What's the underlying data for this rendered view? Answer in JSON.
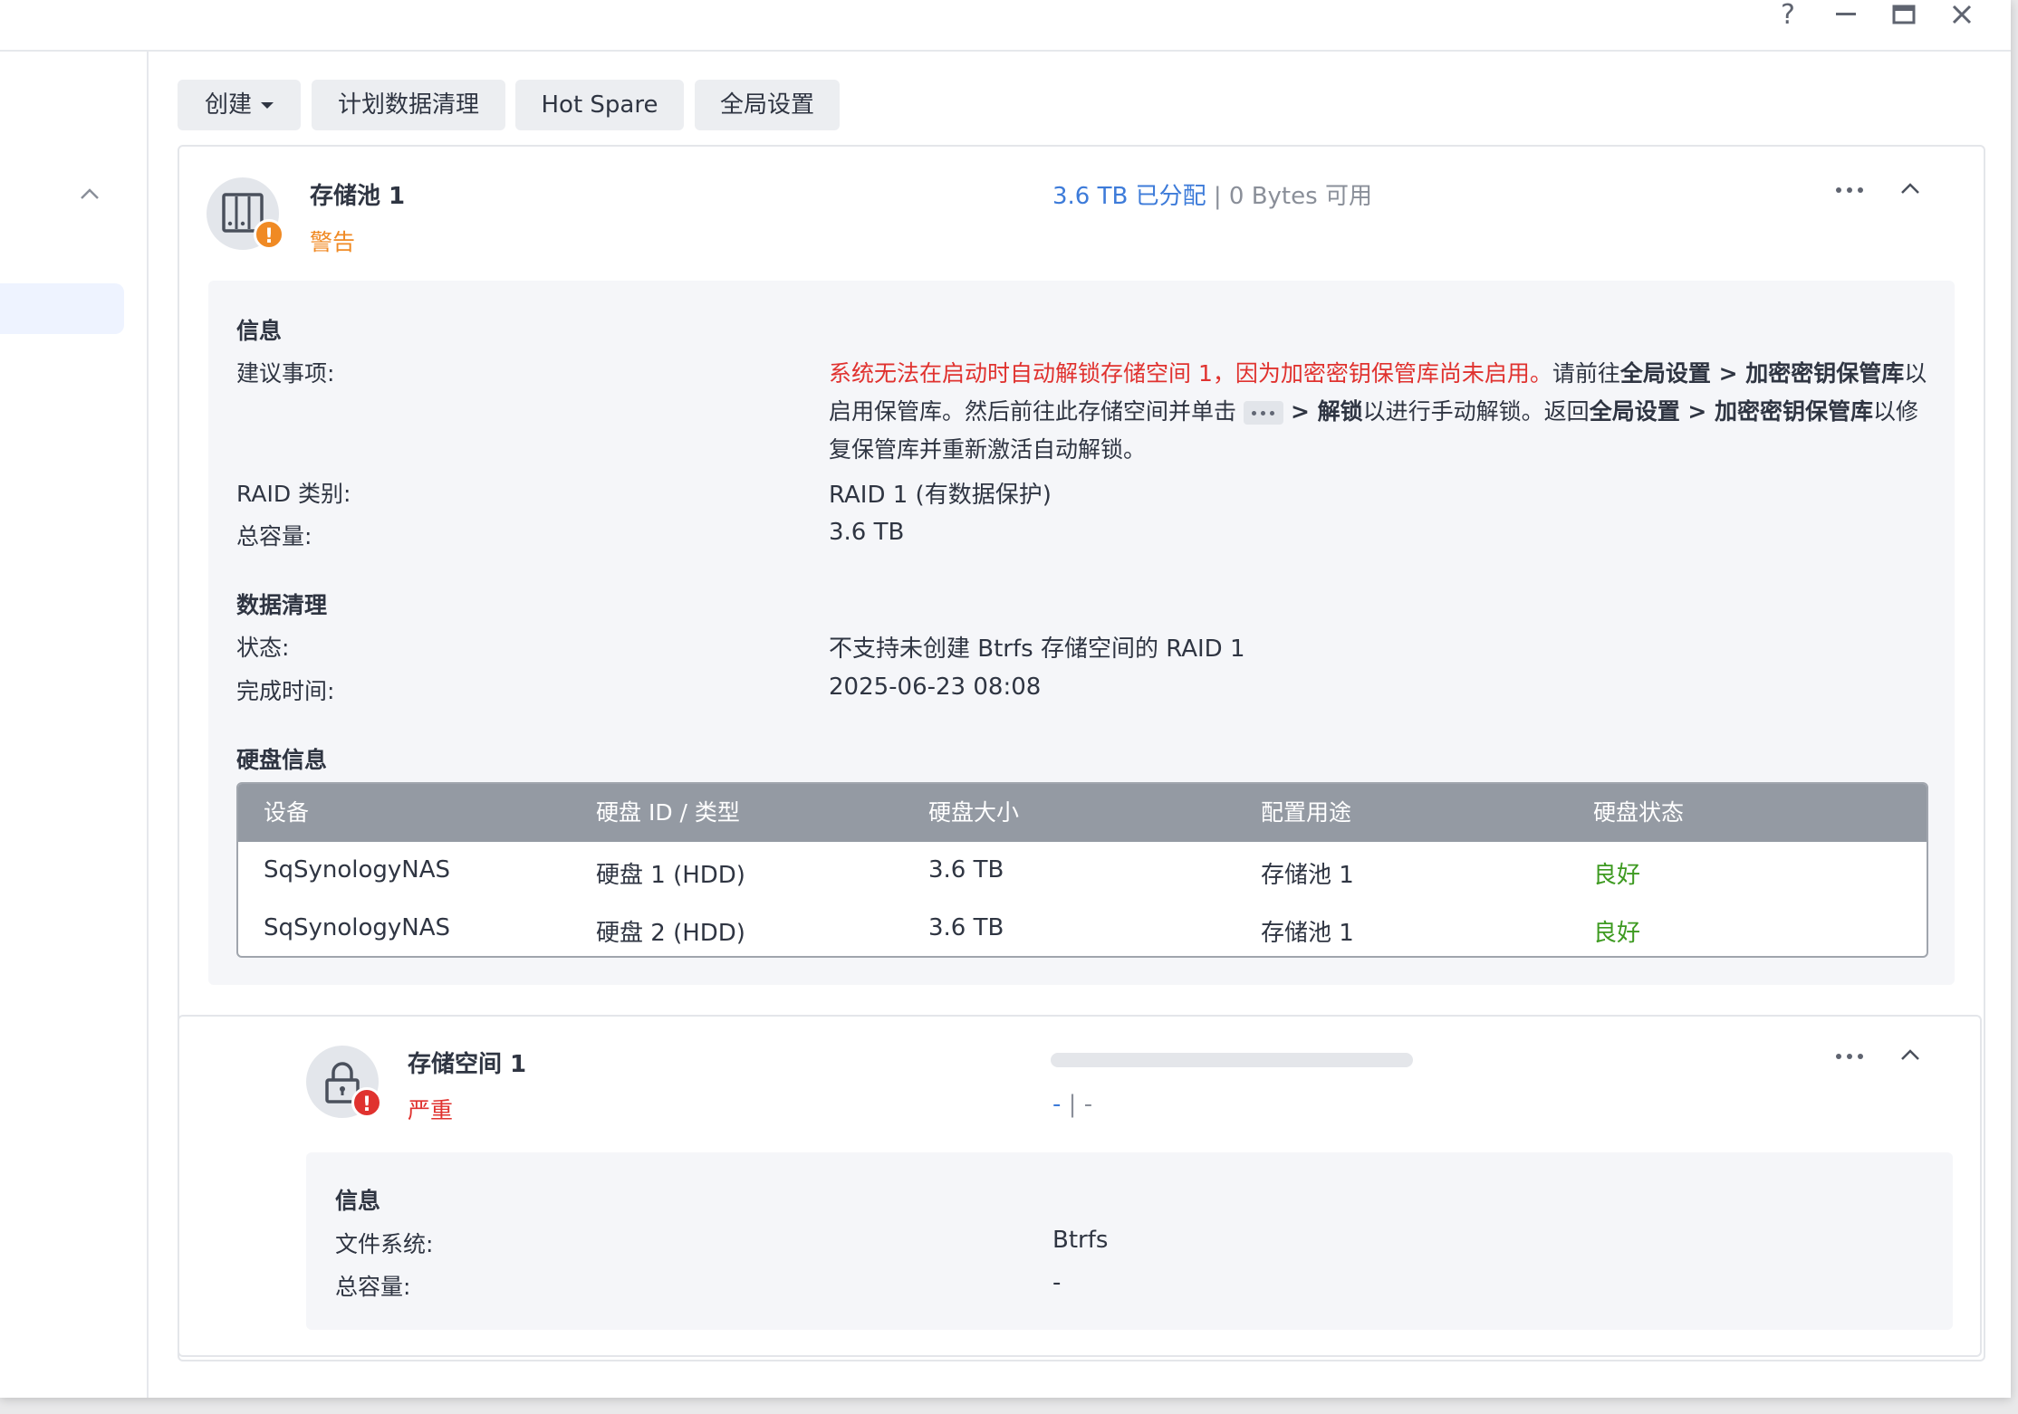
{
  "window_controls": {
    "help": "?",
    "minimize": "—",
    "maximize": "▭",
    "close": "✕"
  },
  "toolbar": {
    "create_label": "创建",
    "scrub_label": "计划数据清理",
    "hotspare_label": "Hot Spare",
    "global_label": "全局设置"
  },
  "pool": {
    "title": "存储池 1",
    "status": "警告",
    "allocated": "3.6 TB 已分配",
    "separator": "|",
    "available": "0 Bytes 可用",
    "info_header": "信息",
    "recommend_label": "建议事项:",
    "recommendation": {
      "red": "系统无法在启动时自动解锁存储空间 1，因为加密密钥保管库尚未启用。",
      "t1": "请前往",
      "b1": "全局设置 > 加密密钥保管库",
      "t2": "以启用保管库。然后前往此存储空间并单击",
      "b2": "> 解锁",
      "t3": "以进行手动解锁。返回",
      "b3": "全局设置 > 加密密钥保管库",
      "t4": "以修复保管库并重新激活自动解锁。"
    },
    "raid_label": "RAID 类别:",
    "raid_value": "RAID 1 (有数据保护)",
    "capacity_label": "总容量:",
    "capacity_value": "3.6 TB",
    "scrub_header": "数据清理",
    "scrub_status_label": "状态:",
    "scrub_status_value": "不支持未创建 Btrfs 存储空间的 RAID 1",
    "scrub_time_label": "完成时间:",
    "scrub_time_value": "2025-06-23 08:08",
    "disk_header": "硬盘信息",
    "table": {
      "columns": [
        "设备",
        "硬盘 ID / 类型",
        "硬盘大小",
        "配置用途",
        "硬盘状态"
      ],
      "rows": [
        [
          "SqSynologyNAS",
          "硬盘 1 (HDD)",
          "3.6 TB",
          "存储池 1",
          "良好"
        ],
        [
          "SqSynologyNAS",
          "硬盘 2 (HDD)",
          "3.6 TB",
          "存储池 1",
          "良好"
        ]
      ]
    }
  },
  "volume": {
    "title": "存储空间 1",
    "status": "严重",
    "usage_left": "-",
    "separator": "|",
    "usage_right": "-",
    "info_header": "信息",
    "fs_label": "文件系统:",
    "fs_value": "Btrfs",
    "capacity_label": "总容量:",
    "capacity_value": "-"
  },
  "colors": {
    "accent": "#3d7bd9",
    "warning": "#f08a24",
    "critical": "#e0322f",
    "good": "#3d9a20"
  }
}
